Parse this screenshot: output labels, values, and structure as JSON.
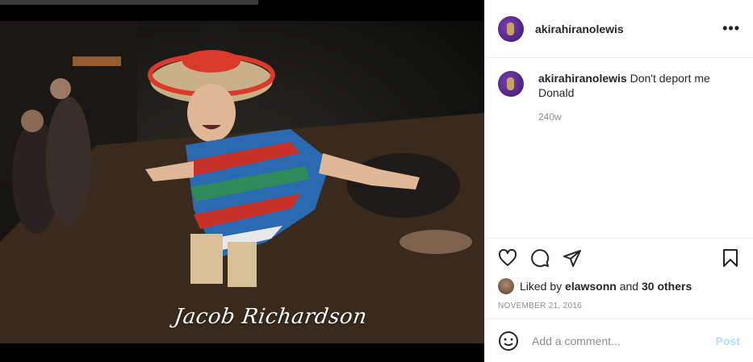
{
  "post": {
    "watermark": "Jacob Richardson",
    "username": "akirahiranolewis",
    "more_icon": "more-horizontal-icon",
    "caption": {
      "username": "akirahiranolewis",
      "text": "Don't deport me Donald"
    },
    "caption_time": "240w",
    "likes": {
      "prefix": "Liked by",
      "user": "elawsonn",
      "middle": "and",
      "others": "30 others"
    },
    "date": "November 21, 2016",
    "comment_placeholder": "Add a comment...",
    "post_label": "Post",
    "icons": [
      "heart-icon",
      "comment-icon",
      "share-icon",
      "bookmark-icon",
      "emoji-icon"
    ]
  },
  "colors": {
    "link_post": "#b2dffc",
    "muted": "#8e8e8e",
    "text": "#262626"
  }
}
